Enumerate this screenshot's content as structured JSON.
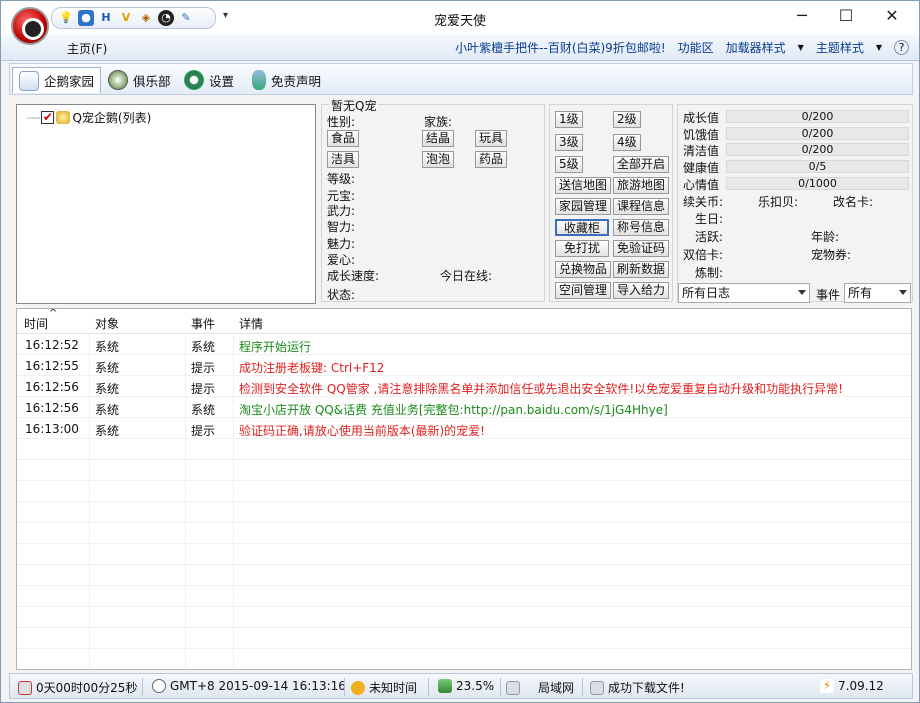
{
  "window": {
    "title": "宠爱天使",
    "minimize": "─",
    "maximize": "☐",
    "close": "✕"
  },
  "quick_access": {
    "icons": [
      "bulb-icon",
      "globe-icon",
      "h-icon",
      "v-icon",
      "gift-icon",
      "penguin-icon",
      "tool-icon"
    ],
    "dropdown": "▾"
  },
  "menu": {
    "home": "主页(F)",
    "promo": "小叶紫檀手把件--百财(白菜)9折包邮啦!",
    "func": "功能区",
    "plugin": "加载器样式",
    "theme": "主题样式",
    "help": "?"
  },
  "tabs": [
    {
      "label": "企鹅家园",
      "icon": "home-icon"
    },
    {
      "label": "俱乐部",
      "icon": "compass-icon"
    },
    {
      "label": "设置",
      "icon": "gear-icon"
    },
    {
      "label": "免责声明",
      "icon": "figure-icon"
    }
  ],
  "tree": {
    "root_label": "Q宠企鹅(列表)",
    "checked": true
  },
  "pet_info": {
    "legend": "暂无Q宠",
    "gender": "性别:",
    "family": "家族:",
    "btn_food": "食品",
    "btn_crystal": "结晶",
    "btn_toy": "玩具",
    "btn_clean": "洁具",
    "btn_bubble": "泡泡",
    "btn_medicine": "药品",
    "level": "等级:",
    "yuanbao": "元宝:",
    "force": "武力:",
    "intel": "智力:",
    "charm": "魅力:",
    "love": "爱心:",
    "growth_speed": "成长速度:",
    "online_today": "今日在线:",
    "state": "状态:"
  },
  "actions": {
    "lv1": "1级",
    "lv2": "2级",
    "lv3": "3级",
    "lv4": "4级",
    "lv5": "5级",
    "all_on": "全部开启",
    "send_map": "送信地图",
    "travel_map": "旅游地图",
    "home_mgmt": "家园管理",
    "course_info": "课程信息",
    "collection": "收藏柜",
    "title_info": "称号信息",
    "no_disturb": "免打扰",
    "no_captcha": "免验证码",
    "exchange": "兑换物品",
    "refresh": "刷新数据",
    "space_mgmt": "空间管理",
    "import_power": "导入给力"
  },
  "stats": {
    "growth": {
      "label": "成长值",
      "value": "0/200"
    },
    "hunger": {
      "label": "饥饿值",
      "value": "0/200"
    },
    "clean": {
      "label": "清洁值",
      "value": "0/200"
    },
    "health": {
      "label": "健康值",
      "value": "0/5"
    },
    "mood": {
      "label": "心情值",
      "value": "0/1000"
    },
    "coins": "续关币:",
    "lekoubei": "乐扣贝:",
    "rename_card": "改名卡:",
    "birthday": "生日:",
    "active": "活跃:",
    "age": "年龄:",
    "double_card": "双倍卡:",
    "pet_ticket": "宠物券:",
    "alchemy": "炼制:"
  },
  "filters": {
    "log_select": "所有日志",
    "event_label": "事件",
    "event_select": "所有"
  },
  "log": {
    "headers": {
      "time": "时间",
      "sort_arrow": "^",
      "target": "对象",
      "event": "事件",
      "detail": "详情"
    },
    "rows": [
      {
        "time": "16:12:52",
        "target": "系统",
        "event": "系统",
        "detail": "程序开始运行",
        "color": "#1a8a1a"
      },
      {
        "time": "16:12:55",
        "target": "系统",
        "event": "提示",
        "detail": "成功注册老板键: Ctrl+F12",
        "color": "#e02020"
      },
      {
        "time": "16:12:56",
        "target": "系统",
        "event": "提示",
        "detail": "检测到安全软件 QQ管家 ,请注意排除黑名单并添加信任或先退出安全软件!以免宠爱重复自动升级和功能执行异常!",
        "color": "#e02020"
      },
      {
        "time": "16:12:56",
        "target": "系统",
        "event": "系统",
        "detail": "淘宝小店开放 QQ&话费 充值业务[完整包:http://pan.baidu.com/s/1jG4Hhye]",
        "color": "#1a8a1a"
      },
      {
        "time": "16:13:00",
        "target": "系统",
        "event": "提示",
        "detail": "验证码正确,请放心使用当前版本(最新)的宠爱!",
        "color": "#e02020"
      }
    ]
  },
  "status": {
    "uptime": "0天00时00分25秒",
    "clock": "GMT+8 2015-09-14 16:13:16",
    "unknown_time": "未知时间",
    "cpu": "23.5%",
    "network": "局域网",
    "download": "成功下载文件!",
    "version": "7.09.12"
  },
  "colors": {
    "accent": "#0b3d91",
    "ok": "#1a8a1a",
    "warn": "#e02020"
  }
}
